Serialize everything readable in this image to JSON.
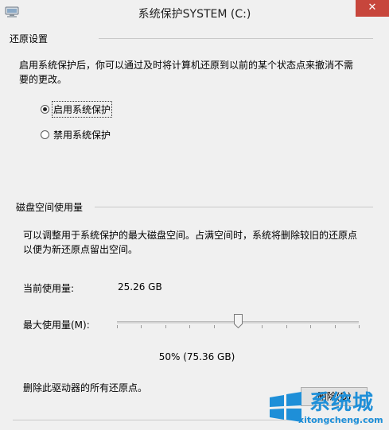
{
  "window": {
    "title": "系统保护SYSTEM (C:)",
    "close_label": "✕"
  },
  "restore_settings": {
    "group_label": "还原设置",
    "description_line1": "启用系统保护后，你可以通过及时将计算机还原到以前的某个状态点来撤消不需",
    "description_line2": "要的更改。",
    "options": [
      {
        "label": "启用系统保护",
        "checked": true
      },
      {
        "label": "禁用系统保护",
        "checked": false
      }
    ]
  },
  "disk_usage": {
    "group_label": "磁盘空间使用量",
    "description_line1": "可以调整用于系统保护的最大磁盘空间。占满空间时，系统将删除较旧的还原点",
    "description_line2": "以便为新还原点留出空间。",
    "current_label": "当前使用量:",
    "current_value": "25.26 GB",
    "max_label": "最大使用量(M):",
    "max_percent": 50,
    "max_text": "50% (75.36 GB)",
    "delete_desc": "删除此驱动器的所有还原点。",
    "delete_button": "删除(D)"
  },
  "watermark": {
    "brand": "系统城",
    "url": "xitongcheng.com"
  }
}
